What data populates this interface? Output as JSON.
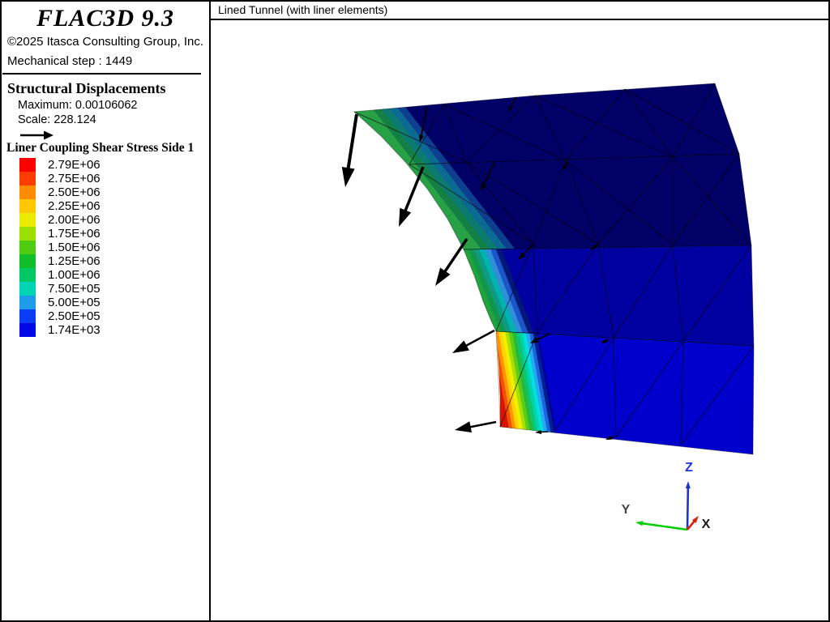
{
  "header": {
    "product": "FLAC3D 9.3",
    "copyright": "©2025 Itasca Consulting Group, Inc.",
    "step_label": "Mechanical step : 1449"
  },
  "view": {
    "title": "Lined Tunnel (with liner elements)"
  },
  "structural": {
    "title": "Structural Displacements",
    "maximum_label": "Maximum: 0.00106062",
    "scale_label": "Scale: 228.124"
  },
  "legend": {
    "title": "Liner Coupling Shear Stress Side 1",
    "items": [
      {
        "color": "#FF0000",
        "label": "2.79E+06"
      },
      {
        "color": "#FF3C00",
        "label": "2.75E+06"
      },
      {
        "color": "#FF8C00",
        "label": "2.50E+06"
      },
      {
        "color": "#FFC800",
        "label": "2.25E+06"
      },
      {
        "color": "#EBEB00",
        "label": "2.00E+06"
      },
      {
        "color": "#9BDE00",
        "label": "1.75E+06"
      },
      {
        "color": "#4FCC12",
        "label": "1.50E+06"
      },
      {
        "color": "#0FBE28",
        "label": "1.25E+06"
      },
      {
        "color": "#00C864",
        "label": "1.00E+06"
      },
      {
        "color": "#00D4B4",
        "label": "7.50E+05"
      },
      {
        "color": "#1E9BE9",
        "label": "5.00E+05"
      },
      {
        "color": "#0A3CF5",
        "label": "2.50E+05"
      },
      {
        "color": "#0008E6",
        "label": "1.74E+03"
      }
    ]
  },
  "axis_triad": {
    "axes": [
      {
        "label": "Z",
        "line_color": "#2233CC",
        "label_color": "#2233DD",
        "from": [
          848,
          654
        ],
        "to": [
          849,
          594
        ],
        "label_at": [
          850,
          582
        ]
      },
      {
        "label": "Y",
        "line_color": "#00CC00",
        "label_color": "#444444",
        "from": [
          848,
          654
        ],
        "to": [
          784,
          645
        ],
        "label_at": [
          772,
          634
        ]
      },
      {
        "label": "X",
        "line_color": "#DD2200",
        "label_color": "#1A1A1A",
        "from": [
          848,
          654
        ],
        "to": [
          862,
          637
        ],
        "label_at": [
          871,
          652
        ]
      }
    ]
  },
  "scene": {
    "body_colors": {
      "ring_top": "#000066",
      "ring_mid": "#0000A0",
      "ring_bottom": "#0000CC"
    },
    "contour_bands": {
      "ring1": [
        "#28A046",
        "#128044",
        "#0C7A6E",
        "#0A6A92",
        "#0E3F8E"
      ],
      "ring2": [
        "#1FA33C",
        "#12964B",
        "#0C9B80",
        "#00B2B2",
        "#2E8FD8",
        "#1C55C8",
        "#001878"
      ],
      "ring3": [
        "#D81400",
        "#F05000",
        "#FF9400",
        "#FFD300",
        "#EFEF00",
        "#A8E000",
        "#5ECC16",
        "#28B83C",
        "#0AC66E",
        "#00D2AA",
        "#00E0E0",
        "#28A8F0",
        "#1A64E0",
        "#002090"
      ]
    },
    "arrow_color": "#000000",
    "displacement_arrows": {
      "large": [
        [
          440,
          141,
          426,
          231,
          4,
          24,
          16
        ],
        [
          522,
          206,
          492,
          280,
          3.5,
          22,
          15
        ],
        [
          576,
          295,
          537,
          353,
          3.5,
          22,
          15
        ],
        [
          610,
          408,
          558,
          436,
          2.5,
          20,
          14
        ],
        [
          612,
          521,
          561,
          531,
          2.5,
          20,
          14
        ]
      ],
      "small": [
        [
          527,
          132,
          518,
          176,
          1.8,
          9,
          6
        ],
        [
          636,
          120,
          627,
          139,
          1.5,
          8,
          5
        ],
        [
          610,
          201,
          593,
          236,
          1.8,
          10,
          7
        ],
        [
          700,
          199,
          694,
          211,
          1.5,
          8,
          5
        ],
        [
          658,
          301,
          639,
          321,
          1.8,
          10,
          7
        ],
        [
          738,
          301,
          728,
          309,
          1.5,
          8,
          5
        ],
        [
          678,
          412,
          654,
          424,
          1.8,
          10,
          7
        ],
        [
          752,
          419,
          741,
          424,
          1.5,
          8,
          5
        ],
        [
          676,
          533,
          660,
          534,
          1.5,
          8,
          5
        ],
        [
          758,
          539,
          747,
          543,
          1.5,
          8,
          5
        ]
      ]
    }
  }
}
